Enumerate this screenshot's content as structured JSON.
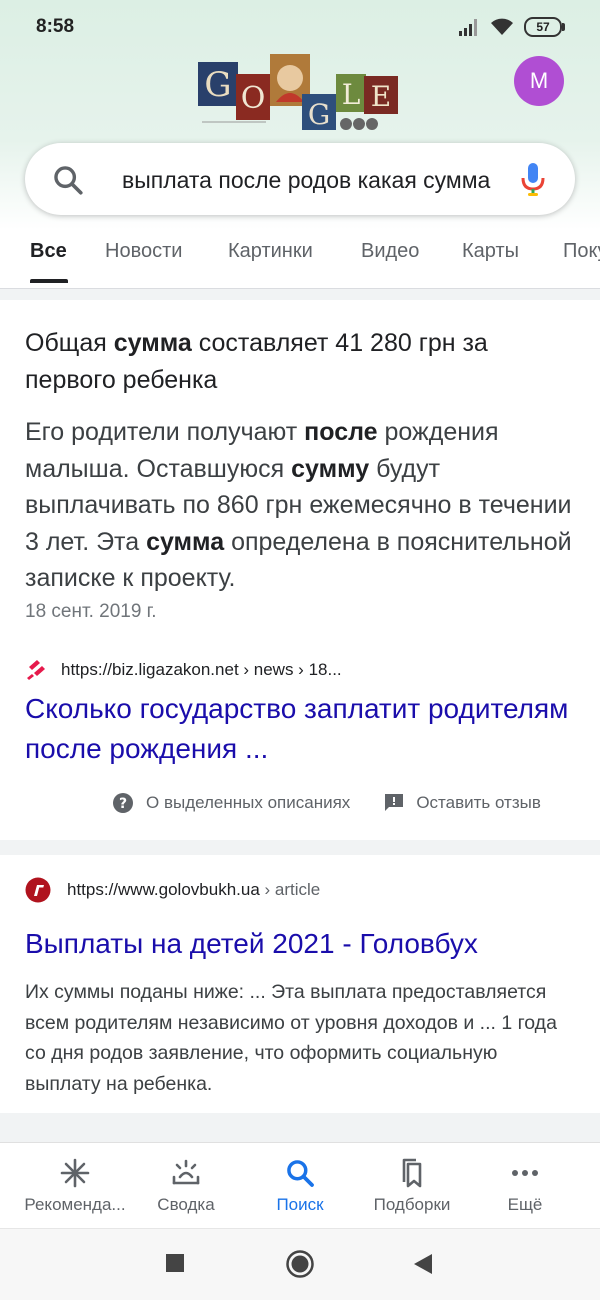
{
  "status_bar": {
    "time": "8:58",
    "battery": "57"
  },
  "account": {
    "initial": "M",
    "color": "#b04ed3"
  },
  "search": {
    "query": "выплата после родов какая сумма"
  },
  "tabs": [
    {
      "label": "Все"
    },
    {
      "label": "Новости"
    },
    {
      "label": "Картинки"
    },
    {
      "label": "Видео"
    },
    {
      "label": "Карты"
    },
    {
      "label": "Покупки"
    }
  ],
  "featured": {
    "answer_pre": "Общая ",
    "answer_bold": "сумма",
    "answer_post": " составляет 41 280 грн за первого ребенка",
    "body": [
      {
        "t": "Его родители получают ",
        "b": false
      },
      {
        "t": "после",
        "b": true
      },
      {
        "t": " рождения малыша. Оставшуюся ",
        "b": false
      },
      {
        "t": "сумму",
        "b": true
      },
      {
        "t": " будут выплачивать по 860 грн ежемесячно в течении 3 лет. Эта ",
        "b": false
      },
      {
        "t": "сумма",
        "b": true
      },
      {
        "t": " определена в пояснительной записке к проекту.",
        "b": false
      }
    ],
    "date": "18 сент. 2019 г.",
    "url": "https://biz.ligazakon.net › news › 18...",
    "title": "Сколько государство заплатит родителям после рождения ...",
    "about_label": "О выделенных описаниях",
    "feedback_label": "Оставить отзыв"
  },
  "result2": {
    "url_domain": "https://www.golovbukh.ua",
    "url_path": " › article",
    "title": "Выплаты на детей 2021 - Головбух",
    "snippet": "Их суммы поданы ниже: ... Эта выплата предоставляется всем родителям независимо от уровня доходов и ... 1 года со дня родов заявление, что оформить социальную выплату на ребенка."
  },
  "bottom_nav": [
    {
      "label": "Рекоменда...",
      "icon": "asterisk-icon"
    },
    {
      "label": "Сводка",
      "icon": "sunrise-icon"
    },
    {
      "label": "Поиск",
      "icon": "search-icon"
    },
    {
      "label": "Подборки",
      "icon": "collections-icon"
    },
    {
      "label": "Ещё",
      "icon": "more-icon"
    }
  ],
  "colors": {
    "link": "#1a0dab",
    "accent": "#1a73e8"
  }
}
